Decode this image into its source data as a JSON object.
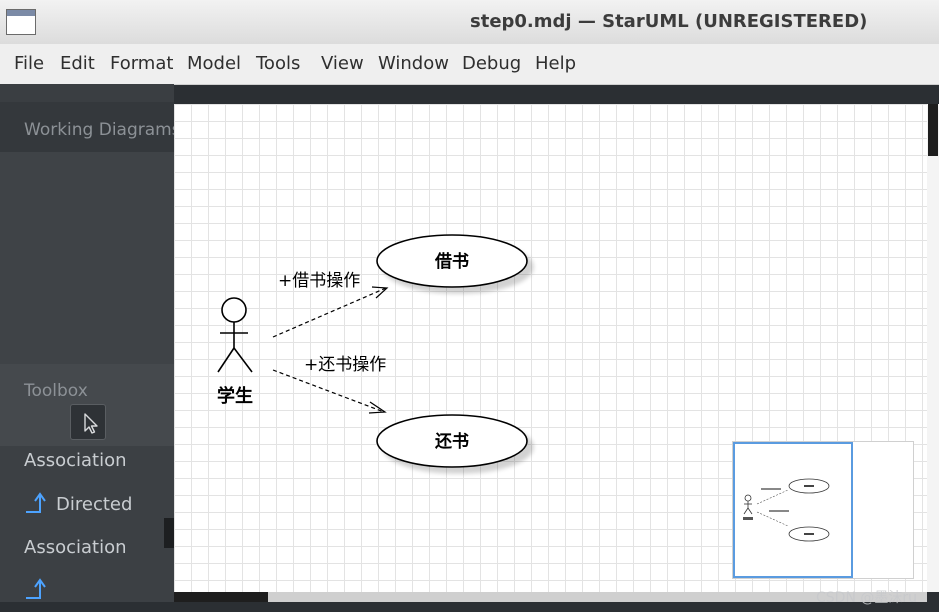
{
  "window": {
    "title": "step0.mdj — StarUML (UNREGISTERED)"
  },
  "menu": {
    "items": [
      "File",
      "Edit",
      "Format",
      "Model",
      "Tools",
      "View",
      "Window",
      "Debug",
      "Help"
    ]
  },
  "sidebar": {
    "working_diagrams_label": "Working Diagrams",
    "toolbox_label": "Toolbox",
    "toolbox_items": [
      {
        "label": "Association",
        "icon": "none"
      },
      {
        "label": "Directed",
        "icon": "directed-association-icon"
      },
      {
        "label": "Association",
        "icon": "none"
      }
    ]
  },
  "diagram": {
    "actor": {
      "name": "学生"
    },
    "use_cases": [
      {
        "name": "借书"
      },
      {
        "name": "还书"
      }
    ],
    "associations": [
      {
        "label": "+借书操作"
      },
      {
        "label": "+还书操作"
      }
    ]
  },
  "colors": {
    "canvas_bg": "#ffffff",
    "grid": "#e3e3e3",
    "sidebar_bg": "#3a3e42",
    "minimap_border": "#5a9be0",
    "ellipse_stroke": "#000000"
  },
  "watermark": {
    "text": "CSDN @墨沫ru"
  }
}
